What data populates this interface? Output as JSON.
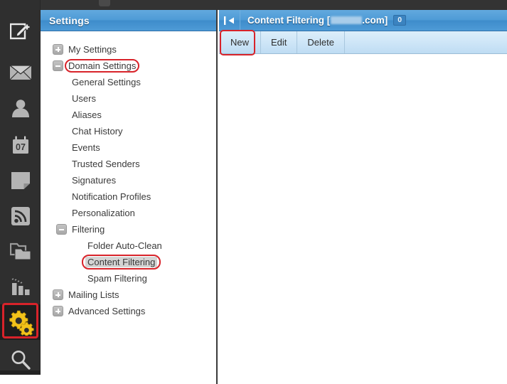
{
  "rail": {
    "items": [
      {
        "name": "compose-icon",
        "label": "Compose"
      },
      {
        "name": "mail-icon",
        "label": "Mail"
      },
      {
        "name": "contacts-icon",
        "label": "Contacts"
      },
      {
        "name": "calendar-icon",
        "label": "Calendar",
        "day": "07"
      },
      {
        "name": "notes-icon",
        "label": "Notes"
      },
      {
        "name": "feeds-icon",
        "label": "RSS Feeds"
      },
      {
        "name": "folders-icon",
        "label": "File Storage"
      },
      {
        "name": "reports-icon",
        "label": "Reports"
      },
      {
        "name": "settings-gear-icon",
        "label": "Settings"
      },
      {
        "name": "search-icon",
        "label": "Search"
      }
    ],
    "active_index": 8,
    "highlight_color": "#d8232a"
  },
  "settings_panel": {
    "title": "Settings",
    "header_color": "#4e9bd6",
    "tree": [
      {
        "label": "My Settings",
        "level": 0,
        "toggle": "plus",
        "selected": false,
        "annotated": false
      },
      {
        "label": "Domain Settings",
        "level": 0,
        "toggle": "minus",
        "selected": false,
        "annotated": true
      },
      {
        "label": "General Settings",
        "level": 1,
        "toggle": "none",
        "selected": false,
        "annotated": false
      },
      {
        "label": "Users",
        "level": 1,
        "toggle": "none",
        "selected": false,
        "annotated": false
      },
      {
        "label": "Aliases",
        "level": 1,
        "toggle": "none",
        "selected": false,
        "annotated": false
      },
      {
        "label": "Chat History",
        "level": 1,
        "toggle": "none",
        "selected": false,
        "annotated": false
      },
      {
        "label": "Events",
        "level": 1,
        "toggle": "none",
        "selected": false,
        "annotated": false
      },
      {
        "label": "Trusted Senders",
        "level": 1,
        "toggle": "none",
        "selected": false,
        "annotated": false
      },
      {
        "label": "Signatures",
        "level": 1,
        "toggle": "none",
        "selected": false,
        "annotated": false
      },
      {
        "label": "Notification Profiles",
        "level": 1,
        "toggle": "none",
        "selected": false,
        "annotated": false
      },
      {
        "label": "Personalization",
        "level": 1,
        "toggle": "none",
        "selected": false,
        "annotated": false
      },
      {
        "label": "Filtering",
        "level": 1,
        "toggle": "minus",
        "selected": false,
        "annotated": false
      },
      {
        "label": "Folder Auto-Clean",
        "level": 2,
        "toggle": "none",
        "selected": false,
        "annotated": false
      },
      {
        "label": "Content Filtering",
        "level": 2,
        "toggle": "none",
        "selected": true,
        "annotated": true
      },
      {
        "label": "Spam Filtering",
        "level": 2,
        "toggle": "none",
        "selected": false,
        "annotated": false
      },
      {
        "label": "Mailing Lists",
        "level": 0,
        "toggle": "plus",
        "selected": false,
        "annotated": false
      },
      {
        "label": "Advanced Settings",
        "level": 0,
        "toggle": "plus",
        "selected": false,
        "annotated": false
      }
    ]
  },
  "content": {
    "collapse_icon": "collapse-left-icon",
    "title_prefix": "Content Filtering [",
    "title_suffix": ".com]",
    "domain_redacted": true,
    "count_badge": "0",
    "toolbar": {
      "buttons": [
        {
          "label": "New",
          "annotated": true
        },
        {
          "label": "Edit",
          "annotated": false
        },
        {
          "label": "Delete",
          "annotated": false
        }
      ]
    }
  }
}
